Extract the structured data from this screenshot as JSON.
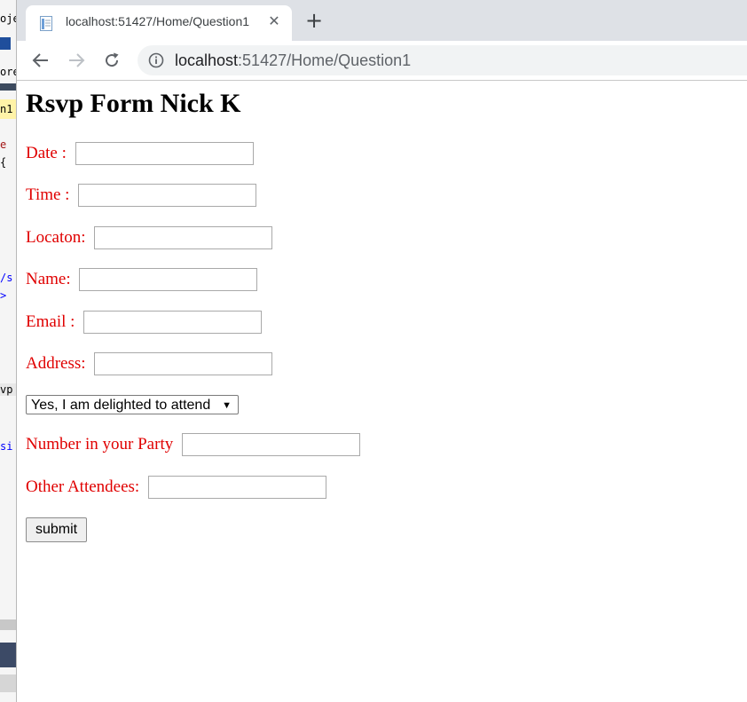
{
  "ide": {
    "fragments": [
      "oje",
      "ore",
      "n1",
      "e",
      "{",
      "/s",
      ">",
      "vp",
      "si"
    ]
  },
  "browser": {
    "tab": {
      "title": "localhost:51427/Home/Question1",
      "close_glyph": "✕",
      "favicon": "page-icon"
    },
    "new_tab_glyph": "+",
    "address": {
      "host": "localhost",
      "path": ":51427/Home/Question1"
    },
    "icons": {
      "back": "back-arrow-icon",
      "forward": "forward-arrow-icon",
      "reload": "reload-icon",
      "info": "info-icon"
    }
  },
  "form": {
    "heading": "Rsvp Form Nick K",
    "fields": [
      {
        "label": "Date : ",
        "value": ""
      },
      {
        "label": "Time : ",
        "value": ""
      },
      {
        "label": "Locaton: ",
        "value": ""
      },
      {
        "label": "Name: ",
        "value": ""
      },
      {
        "label": "Email : ",
        "value": ""
      },
      {
        "label": "Address: ",
        "value": ""
      }
    ],
    "attend_select": {
      "selected": "Yes, I am delighted to attend",
      "arrow": "▼"
    },
    "party_field": {
      "label": "Number in your Party ",
      "value": ""
    },
    "other_field": {
      "label": "Other Attendees: ",
      "value": ""
    },
    "submit_label": "submit"
  },
  "colors": {
    "label": "#e00000",
    "tabstrip": "#dee1e6",
    "omnibox": "#f1f3f4"
  }
}
